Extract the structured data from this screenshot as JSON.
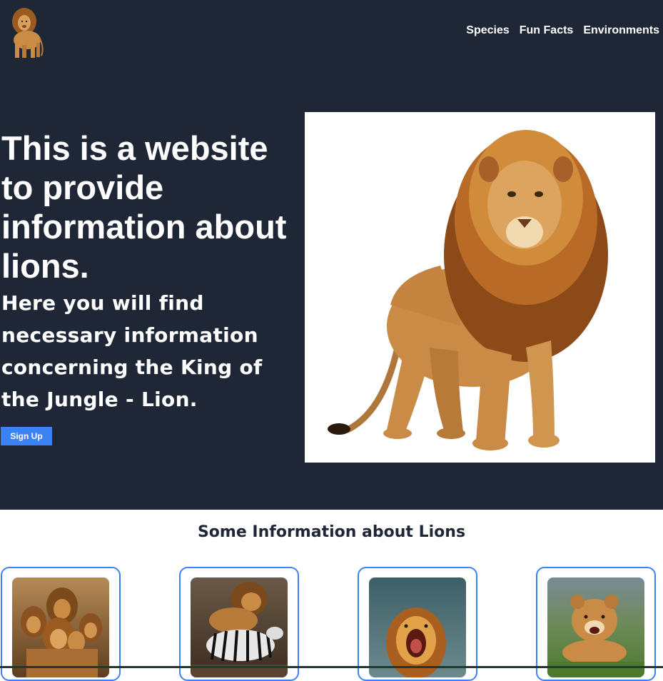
{
  "header": {
    "logo_icon": "lion-logo-icon",
    "nav": [
      {
        "label": "Species"
      },
      {
        "label": "Fun Facts"
      },
      {
        "label": "Environments"
      }
    ]
  },
  "hero": {
    "title": "This is a website to provide information about lions.",
    "subtitle": "Here you will find necessary information concerning the King of the Jungle - Lion.",
    "signup_label": "Sign Up",
    "image_icon": "standing-lion-image"
  },
  "info": {
    "title": "Some Information about Lions",
    "cards": [
      {
        "icon": "lion-pride-image"
      },
      {
        "icon": "lion-hunting-zebra-image"
      },
      {
        "icon": "roaring-lion-image"
      },
      {
        "icon": "lion-cub-image"
      }
    ]
  },
  "colors": {
    "background_dark": "#1f2737",
    "accent": "#3b82f6",
    "text_light": "#ffffff"
  }
}
